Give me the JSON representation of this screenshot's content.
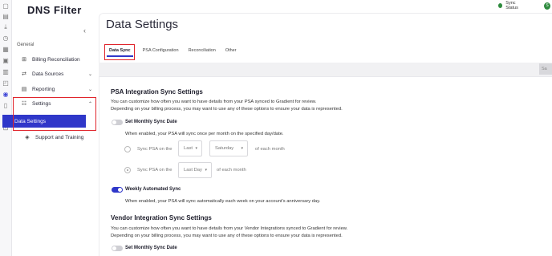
{
  "brand": {
    "logo_text": "DNS Filter"
  },
  "topbar": {
    "sync_status": "Sync Status",
    "avatar_letter": "S"
  },
  "sidebar": {
    "collapse_icon": "chevron-left-icon",
    "section": "General",
    "items": [
      {
        "label": "Billing Reconciliation",
        "icon": "billing-icon"
      },
      {
        "label": "Data Sources",
        "icon": "data-sources-icon",
        "chevron": "⌄"
      },
      {
        "label": "Reporting",
        "icon": "reporting-icon",
        "chevron": "⌄"
      },
      {
        "label": "Settings",
        "icon": "settings-icon",
        "chevron": "⌃"
      },
      {
        "label": "Data Settings"
      },
      {
        "label": "Support and Training",
        "icon": "support-icon"
      }
    ]
  },
  "page": {
    "title": "Data Settings"
  },
  "tabs": [
    {
      "label": "Data Sync",
      "active": true
    },
    {
      "label": "PSA Configuration"
    },
    {
      "label": "Reconciliation"
    },
    {
      "label": "Other"
    }
  ],
  "save_button": "Sa",
  "psa": {
    "heading": "PSA Integration Sync Settings",
    "desc1": "You can customize how often you want to have details from your PSA synced to Gradient for review.",
    "desc2": "Depending on your billing process, you may want to use any of these options to ensure your data is represented.",
    "monthly_label": "Set Monthly Sync Date",
    "monthly_on": false,
    "monthly_hint": "When enabled, your PSA will sync once per month on the specified day/date.",
    "row1": {
      "prefix": "Sync PSA on the",
      "select1": "Last",
      "select2": "Saturday",
      "suffix": "of each month"
    },
    "row2": {
      "prefix": "Sync PSA on the",
      "select1": "Last Day",
      "suffix": "of each month"
    },
    "weekly_label": "Weekly Automated Sync",
    "weekly_on": true,
    "weekly_hint": "When enabled, your PSA will sync automatically each week on your account's anniversary day."
  },
  "vendor": {
    "heading": "Vendor Integration Sync Settings",
    "desc1": "You can customize how often you want to have details from your Vendor Integrations synced to Gradient for review.",
    "desc2": "Depending on your billing process, you may want to use any of these options to ensure your data is represented.",
    "monthly_label": "Set Monthly Sync Date",
    "monthly_on": false
  },
  "colors": {
    "accent": "#2f37c9",
    "highlight": "#e0252c",
    "sync_ok": "#2e8b3e"
  }
}
